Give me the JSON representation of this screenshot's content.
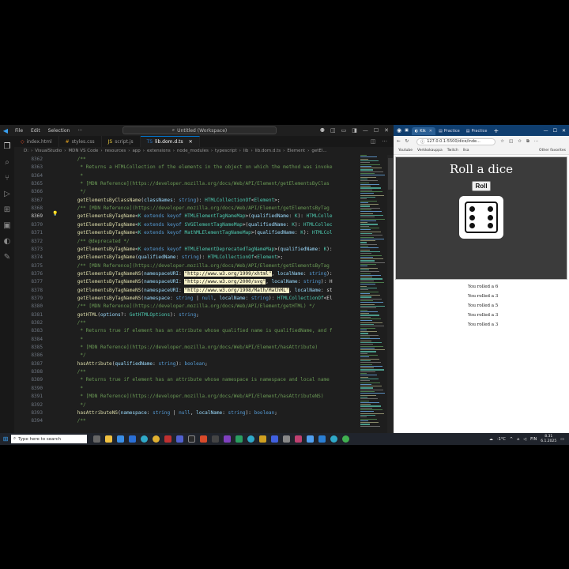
{
  "vscode": {
    "menu": [
      "File",
      "Edit",
      "Selection",
      "···"
    ],
    "command_center": "Untitled (Workspace)",
    "tabs": [
      {
        "label": "index.html",
        "icon": "html-file-icon",
        "color": "#e44d26"
      },
      {
        "label": "styles.css",
        "icon": "css-file-icon",
        "color": "#e0a020"
      },
      {
        "label": "script.js",
        "icon": "js-file-icon",
        "color": "#f0d040"
      },
      {
        "label": "lib.dom.d.ts",
        "icon": "ts-file-icon",
        "color": "#3178c6"
      }
    ],
    "active_tab": "lib.dom.d.ts",
    "breadcrumb": [
      "D:",
      "VisualStudio",
      "MDN VS Code",
      "resources",
      "app",
      "extensions",
      "node_modules",
      "typescript",
      "lib",
      "lib.dom.d.ts",
      "Element",
      "getEl..."
    ],
    "lines": [
      {
        "n": "8362",
        "t": "    /**"
      },
      {
        "n": "8363",
        "t": "     * Returns a HTMLCollection of the elements in the object on which the method was invoke"
      },
      {
        "n": "8364",
        "t": "     *"
      },
      {
        "n": "8365",
        "t": "     * [MDN Reference](https://developer.mozilla.org/docs/Web/API/Element/getElementsByClas"
      },
      {
        "n": "8366",
        "t": "     */"
      },
      {
        "n": "8367",
        "t": "    getElementsByClassName(classNames: string): HTMLCollectionOf<Element>;"
      },
      {
        "n": "8368",
        "t": "    /** [MDN Reference](https://developer.mozilla.org/docs/Web/API/Element/getElementsByTag"
      },
      {
        "n": "8369",
        "t": "    getElementsByTagName<K extends keyof HTMLElementTagNameMap>(qualifiedName: K): HTMLColle"
      },
      {
        "n": "8370",
        "t": "    getElementsByTagName<K extends keyof SVGElementTagNameMap>(qualifiedName: K): HTMLCollec"
      },
      {
        "n": "8371",
        "t": "    getElementsByTagName<K extends keyof MathMLElementTagNameMap>(qualifiedName: K): HTMLCol"
      },
      {
        "n": "8372",
        "t": "    /** @deprecated */"
      },
      {
        "n": "8373",
        "t": "    getElementsByTagName<K extends keyof HTMLElementDeprecatedTagNameMap>(qualifiedName: K):"
      },
      {
        "n": "8374",
        "t": "    getElementsByTagName(qualifiedName: string): HTMLCollectionOf<Element>;"
      },
      {
        "n": "8375",
        "t": "    /** [MDN Reference](https://developer.mozilla.org/docs/Web/API/Element/getElementsByTag"
      },
      {
        "n": "8376",
        "t": "    getElementsByTagNameNS(namespaceURI: \"http://www.w3.org/1999/xhtml\", localName: string):"
      },
      {
        "n": "8377",
        "t": "    getElementsByTagNameNS(namespaceURI: \"http://www.w3.org/2000/svg\", localName: string): H"
      },
      {
        "n": "8378",
        "t": "    getElementsByTagNameNS(namespaceURI: \"http://www.w3.org/1998/Math/MathML\", localName: st"
      },
      {
        "n": "8379",
        "t": "    getElementsByTagNameNS(namespace: string | null, localName: string): HTMLCollectionOf<El"
      },
      {
        "n": "8380",
        "t": "    /** [MDN Reference](https://developer.mozilla.org/docs/Web/API/Element/getHTML) */"
      },
      {
        "n": "8381",
        "t": "    getHTML(options?: GetHTMLOptions): string;"
      },
      {
        "n": "8382",
        "t": "    /**"
      },
      {
        "n": "8383",
        "t": "     * Returns true if element has an attribute whose qualified name is qualifiedName, and f"
      },
      {
        "n": "8384",
        "t": "     *"
      },
      {
        "n": "8385",
        "t": "     * [MDN Reference](https://developer.mozilla.org/docs/Web/API/Element/hasAttribute)"
      },
      {
        "n": "8386",
        "t": "     */"
      },
      {
        "n": "8387",
        "t": "    hasAttribute(qualifiedName: string): boolean;"
      },
      {
        "n": "8388",
        "t": "    /**"
      },
      {
        "n": "8389",
        "t": "     * Returns true if element has an attribute whose namespace is namespace and local name"
      },
      {
        "n": "8390",
        "t": "     *"
      },
      {
        "n": "8391",
        "t": "     * [MDN Reference](https://developer.mozilla.org/docs/Web/API/Element/hasAttributeNS)"
      },
      {
        "n": "8392",
        "t": "     */"
      },
      {
        "n": "8393",
        "t": "    hasAttributeNS(namespace: string | null, localName: string): boolean;"
      },
      {
        "n": "8394",
        "t": "    /**"
      }
    ],
    "current_line": "8369"
  },
  "browser": {
    "tabs": [
      {
        "label": "Kik",
        "icon": "page-icon"
      },
      {
        "label": "Practice",
        "icon": "page-icon"
      },
      {
        "label": "Practice",
        "icon": "page-icon"
      }
    ],
    "url": "127.0.0.1:5500/dice/inde...",
    "bookmarks": [
      "Youtube",
      "Verkkokauppa",
      "Twitch",
      "Ilsa"
    ],
    "other_bookmarks": "Other favorites",
    "page_title": "Roll a dice",
    "roll_button": "Roll",
    "die_value": 6,
    "rolls": [
      "You rolled a 6",
      "You rolled a 3",
      "You rolled a 5",
      "You rolled a 3",
      "You rolled a 3"
    ]
  },
  "taskbar": {
    "search_placeholder": "Type here to search",
    "weather": "-1°C",
    "lang": "FIN",
    "time": "8.31",
    "date": "6.1.2025"
  }
}
